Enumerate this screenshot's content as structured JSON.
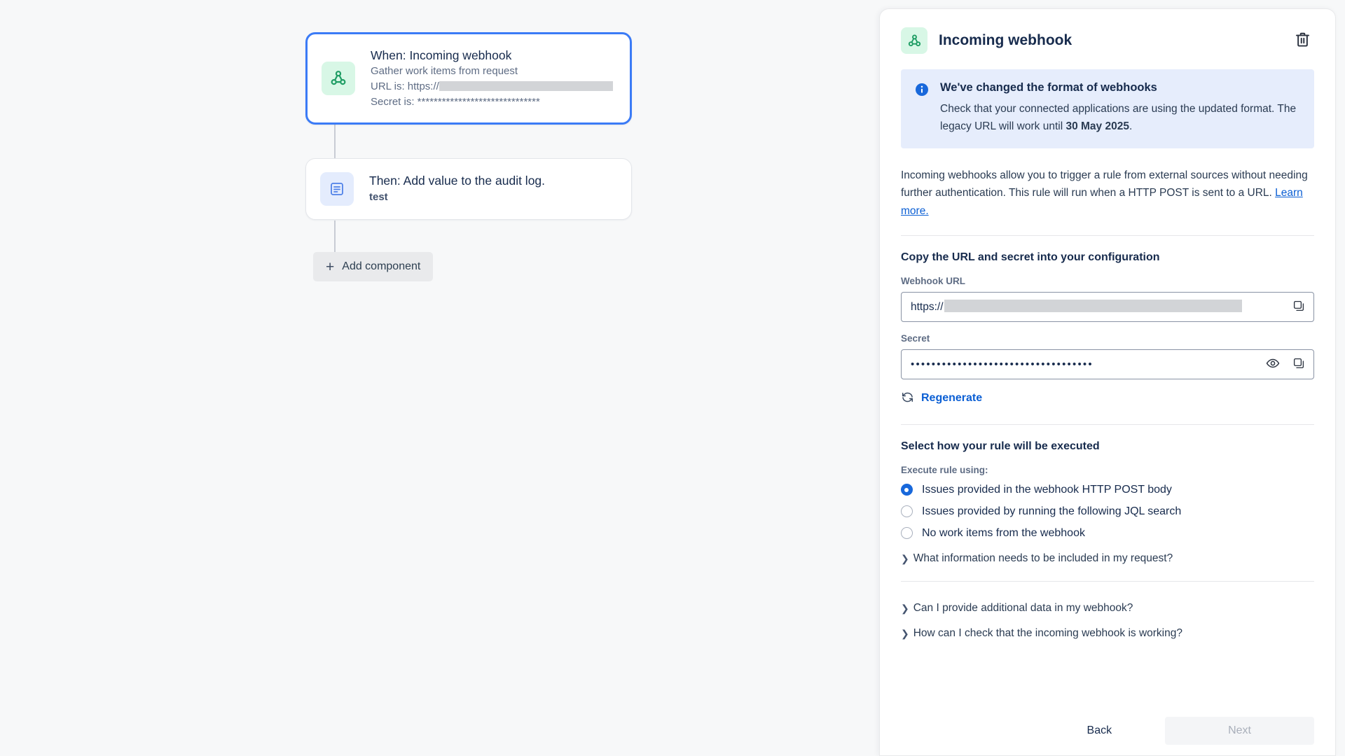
{
  "canvas": {
    "nodes": [
      {
        "icon": "webhook-icon",
        "title": "When: Incoming webhook",
        "subtitle": "Gather work items from request",
        "url_label": "URL is: https://",
        "secret_label": "Secret is: ******************************"
      },
      {
        "icon": "audit-log-icon",
        "title": "Then: Add value to the audit log.",
        "subtitle": "test"
      }
    ],
    "add_component_label": "Add component"
  },
  "panel": {
    "header": {
      "icon": "webhook-icon",
      "title": "Incoming webhook",
      "delete_icon": "trash-icon"
    },
    "info_box": {
      "icon": "info-icon",
      "title": "We've changed the format of webhooks",
      "body": "Check that your connected applications are using the updated format. The legacy URL will work until ",
      "body_bold": "30 May 2025",
      "body_tail": "."
    },
    "description": {
      "text": "Incoming webhooks allow you to trigger a rule from external sources without needing further authentication. This rule will run when a HTTP POST is sent to a URL. ",
      "link": "Learn more."
    },
    "copy_section": {
      "heading": "Copy the URL and secret into your configuration",
      "url_label": "Webhook URL",
      "url_value": "https://",
      "url_copy_icon": "copy-icon",
      "secret_label": "Secret",
      "secret_value": "•••••••••••••••••••••••••••••••••••",
      "secret_reveal_icon": "eye-icon",
      "secret_copy_icon": "copy-icon",
      "regenerate_label": "Regenerate",
      "regenerate_icon": "refresh-icon"
    },
    "execute_section": {
      "heading": "Select how your rule will be executed",
      "label": "Execute rule using:",
      "options": [
        {
          "label": "Issues provided in the webhook HTTP POST body",
          "selected": true
        },
        {
          "label": "Issues provided by running the following JQL search",
          "selected": false
        },
        {
          "label": "No work items from the webhook",
          "selected": false
        }
      ]
    },
    "faq_primary": [
      {
        "label": "What information needs to be included in my request?",
        "icon": "chevron-right-icon"
      }
    ],
    "faq_secondary": [
      {
        "label": "Can I provide additional data in my webhook?",
        "icon": "chevron-right-icon"
      },
      {
        "label": "How can I check that the incoming webhook is working?",
        "icon": "chevron-right-icon"
      }
    ],
    "footer": {
      "back_label": "Back",
      "next_label": "Next"
    }
  },
  "colors": {
    "accent_blue": "#1868db",
    "link_blue": "#0b5fd4",
    "webhook_green": "#22a06b",
    "info_bg": "#e6edfc",
    "canvas_bg": "#f7f8f9"
  }
}
